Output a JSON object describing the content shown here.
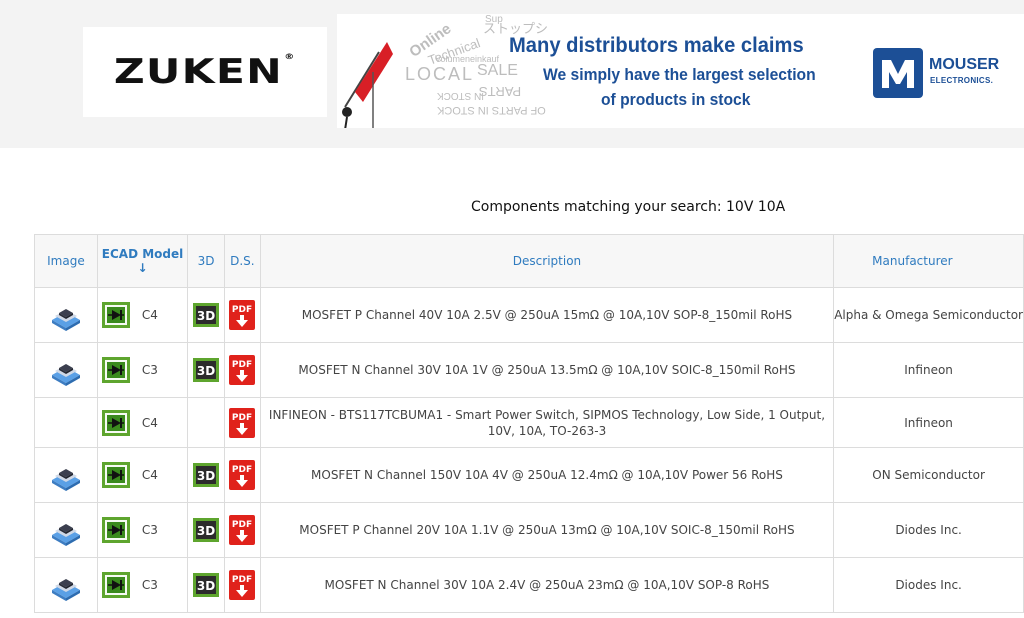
{
  "banners": {
    "zuken": {
      "wordmark": "ZUKEN",
      "registered": "®"
    },
    "mouser": {
      "headline": "Many distributors make claims",
      "line2": "We simply have the largest selection",
      "line3": "of products in stock",
      "brand": "MOUSER",
      "brand_sub": "ELECTRONICS.",
      "word_cloud": [
        "Online",
        "Technical",
        "LOCAL",
        "SALE",
        "Volumeneinkauf",
        "PARTS",
        "IN STOCK",
        "MILLIONS OF PARTS IN STOCK",
        "ストップショ",
        "Sup"
      ]
    }
  },
  "search": {
    "caption": "Components matching your search: 10V 10A"
  },
  "table": {
    "headers": {
      "image": "Image",
      "ecad": "ECAD Model",
      "ecad_arrow": "↓",
      "cad3d": "3D",
      "ds": "D.S.",
      "description": "Description",
      "manufacturer": "Manufacturer"
    },
    "rows": [
      {
        "image": "chip",
        "ecad_level": "C4",
        "has3d": true,
        "pdf_label": "PDF",
        "description": "MOSFET P Channel 40V 10A 2.5V @ 250uA 15mΩ @ 10A,10V SOP-8_150mil RoHS",
        "manufacturer": "Alpha & Omega Semiconductor"
      },
      {
        "image": "chip",
        "ecad_level": "C3",
        "has3d": true,
        "pdf_label": "PDF",
        "description": "MOSFET N Channel 30V 10A 1V @ 250uA 13.5mΩ @ 10A,10V SOIC-8_150mil RoHS",
        "manufacturer": "Infineon"
      },
      {
        "image": "",
        "ecad_level": "C4",
        "has3d": false,
        "pdf_label": "PDF",
        "description": "INFINEON - BTS117TCBUMA1 - Smart Power Switch, SIPMOS Technology, Low Side, 1 Output, 10V, 10A, TO-263-3",
        "manufacturer": "Infineon"
      },
      {
        "image": "chip",
        "ecad_level": "C4",
        "has3d": true,
        "pdf_label": "PDF",
        "description": "MOSFET N Channel 150V 10A 4V @ 250uA 12.4mΩ @ 10A,10V Power 56 RoHS",
        "manufacturer": "ON Semiconductor"
      },
      {
        "image": "chip",
        "ecad_level": "C3",
        "has3d": true,
        "pdf_label": "PDF",
        "description": "MOSFET P Channel 20V 10A 1.1V @ 250uA 13mΩ @ 10A,10V SOIC-8_150mil RoHS",
        "manufacturer": "Diodes Inc."
      },
      {
        "image": "chip",
        "ecad_level": "C3",
        "has3d": true,
        "pdf_label": "PDF",
        "description": "MOSFET N Channel 30V 10A 2.4V @ 250uA 23mΩ @ 10A,10V SOP-8 RoHS",
        "manufacturer": "Diodes Inc."
      }
    ]
  },
  "colors": {
    "link_blue": "#2f7bbf",
    "header_bg": "#f7f7f7",
    "pdf_red": "#e0221b",
    "ecad_green": "#5ea52e",
    "mouser_blue": "#1c4f96"
  }
}
